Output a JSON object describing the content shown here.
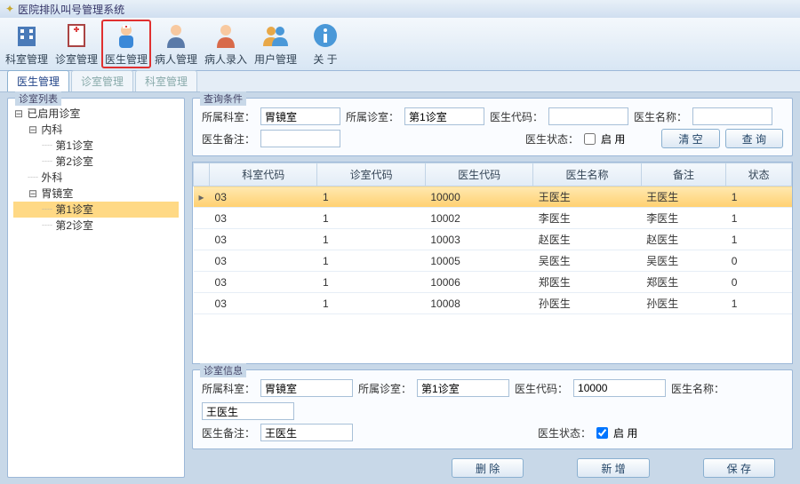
{
  "window": {
    "title": "医院排队叫号管理系统"
  },
  "toolbar": [
    {
      "label": "科室管理",
      "name": "dept-manage",
      "icon": "building"
    },
    {
      "label": "诊室管理",
      "name": "room-manage",
      "icon": "doc"
    },
    {
      "label": "医生管理",
      "name": "doctor-manage",
      "icon": "doctor",
      "active": true
    },
    {
      "label": "病人管理",
      "name": "patient-manage",
      "icon": "patient"
    },
    {
      "label": "病人录入",
      "name": "patient-entry",
      "icon": "patient2"
    },
    {
      "label": "用户管理",
      "name": "user-manage",
      "icon": "users"
    },
    {
      "label": "关 于",
      "name": "about",
      "icon": "info"
    }
  ],
  "subtabs": [
    {
      "label": "医生管理",
      "active": true
    },
    {
      "label": "诊室管理",
      "active": false
    },
    {
      "label": "科室管理",
      "active": false
    }
  ],
  "sidebar": {
    "title": "诊室列表",
    "tree": [
      {
        "label": "已启用诊室",
        "depth": 0,
        "toggle": "-"
      },
      {
        "label": "内科",
        "depth": 1,
        "toggle": "-"
      },
      {
        "label": "第1诊室",
        "depth": 2,
        "dash": true
      },
      {
        "label": "第2诊室",
        "depth": 2,
        "dash": true
      },
      {
        "label": "外科",
        "depth": 1,
        "dash": true
      },
      {
        "label": "胃镜室",
        "depth": 1,
        "toggle": "-"
      },
      {
        "label": "第1诊室",
        "depth": 2,
        "dash": true,
        "selected": true
      },
      {
        "label": "第2诊室",
        "depth": 2,
        "dash": true
      }
    ]
  },
  "query": {
    "title": "查询条件",
    "dept_label": "所属科室：",
    "dept_value": "胃镜室",
    "room_label": "所属诊室：",
    "room_value": "第1诊室",
    "doc_code_label": "医生代码：",
    "doc_code_value": "",
    "doc_name_label": "医生名称：",
    "doc_name_value": "",
    "remark_label": "医生备注：",
    "remark_value": "",
    "status_label": "医生状态：",
    "status_chk_label": "启 用",
    "clear_btn": "清 空",
    "search_btn": "查 询"
  },
  "grid": {
    "headers": [
      "科室代码",
      "诊室代码",
      "医生代码",
      "医生名称",
      "备注",
      "状态"
    ],
    "rows": [
      {
        "cells": [
          "03",
          "1",
          "10000",
          "王医生",
          "王医生",
          "1"
        ],
        "selected": true,
        "marker": "▸"
      },
      {
        "cells": [
          "03",
          "1",
          "10002",
          "李医生",
          "李医生",
          "1"
        ]
      },
      {
        "cells": [
          "03",
          "1",
          "10003",
          "赵医生",
          "赵医生",
          "1"
        ]
      },
      {
        "cells": [
          "03",
          "1",
          "10005",
          "吴医生",
          "吴医生",
          "0"
        ]
      },
      {
        "cells": [
          "03",
          "1",
          "10006",
          "郑医生",
          "郑医生",
          "0"
        ]
      },
      {
        "cells": [
          "03",
          "1",
          "10008",
          "孙医生",
          "孙医生",
          "1"
        ]
      }
    ]
  },
  "detail": {
    "title": "诊室信息",
    "dept_label": "所属科室：",
    "dept_value": "胃镜室",
    "room_label": "所属诊室：",
    "room_value": "第1诊室",
    "doc_code_label": "医生代码：",
    "doc_code_value": "10000",
    "doc_name_label": "医生名称：",
    "doc_name_value": "王医生",
    "remark_label": "医生备注：",
    "remark_value": "王医生",
    "status_label": "医生状态：",
    "status_chk_label": "启 用",
    "status_checked": true
  },
  "actions": {
    "delete": "删 除",
    "add": "新 增",
    "save": "保 存"
  }
}
